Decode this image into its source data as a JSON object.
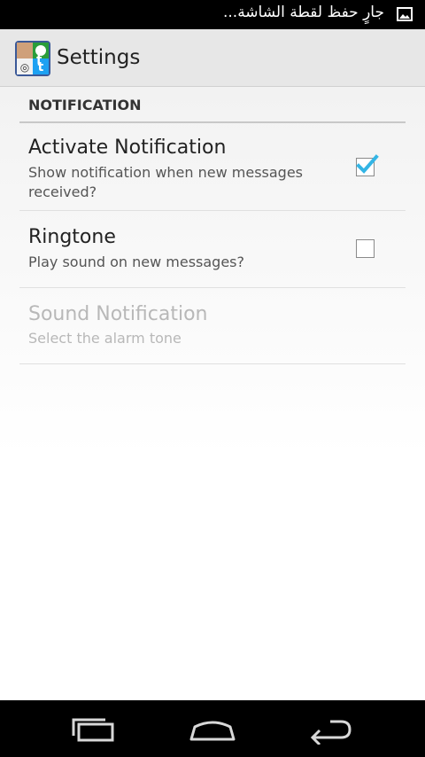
{
  "status_bar": {
    "text": "جارٍ حفظ لقطة الشاشة...",
    "icon": "image-icon"
  },
  "action_bar": {
    "app_icon": "social-collage-app-icon",
    "title": "Settings"
  },
  "category": {
    "title": "NOTIFICATION"
  },
  "preferences": [
    {
      "title": "Activate Notification",
      "summary": "Show notification when new messages received?",
      "checked": true,
      "enabled": true
    },
    {
      "title": "Ringtone",
      "summary": "Play sound on new messages?",
      "checked": false,
      "enabled": true
    },
    {
      "title": "Sound Notification",
      "summary": "Select the alarm tone",
      "enabled": false
    }
  ],
  "nav_bar": {
    "buttons": [
      "recent-apps-icon",
      "home-icon",
      "back-icon"
    ]
  },
  "colors": {
    "checkmark": "#33b5e5",
    "status_bar": "#000000",
    "action_bar": "#e7e7e7"
  }
}
